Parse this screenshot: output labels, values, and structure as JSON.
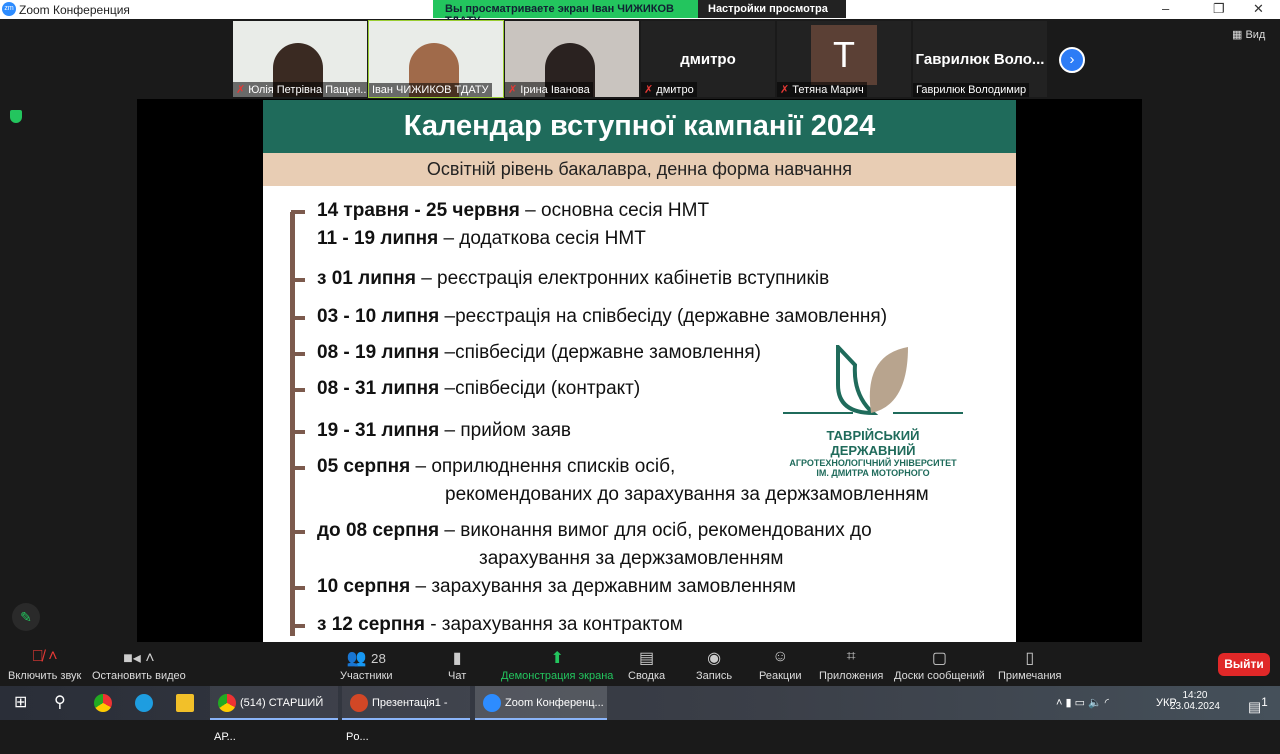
{
  "window": {
    "title": "Zoom Конференция",
    "minimize": "–",
    "maximize": "❐",
    "close": "✕"
  },
  "banner": {
    "viewing": "Вы просматриваете экран Іван ЧИЖИКОВ ТДАТУ",
    "settings": "Настройки просмотра",
    "chevron": "⌄"
  },
  "participants": [
    {
      "name": "Юлія Петрівна Пащен...",
      "muted": true
    },
    {
      "name": "Іван ЧИЖИКОВ ТДАТУ",
      "muted": false
    },
    {
      "name": "Ірина Іванова",
      "muted": true
    },
    {
      "name": "дмитро",
      "display": "дмитро",
      "muted": true
    },
    {
      "name": "Тетяна Марич",
      "display": "Т",
      "muted": true
    },
    {
      "name": "Гаврилюк Володимир",
      "display": "Гаврилюк  Воло...",
      "muted": false
    }
  ],
  "view_label": "Вид",
  "slide": {
    "title": "Календар вступної кампанії 2024",
    "subtitle": "Освітній рівень бакалавра, денна форма навчання",
    "items": [
      {
        "bold": "14 травня - 25 червня",
        "text": " – основна сесія НМТ"
      },
      {
        "bold": "11 - 19 липня",
        "text": " – додаткова сесія НМТ"
      },
      {
        "bold": "з 01 липня",
        "text": " – реєстрація електронних кабінетів вступників"
      },
      {
        "bold": "03 - 10 липня",
        "text": " –реєстрація на співбесіду (державне замовлення)"
      },
      {
        "bold": "08 - 19 липня",
        "text": " –співбесіди (державне замовлення)"
      },
      {
        "bold": "08 - 31 липня",
        "text": " –співбесіди (контракт)"
      },
      {
        "bold": "19 - 31 липня",
        "text": " – прийом заяв"
      },
      {
        "bold": "05 серпня",
        "text": " – оприлюднення списків осіб,",
        "cont": "рекомендованих до зарахування за держзамовленням"
      },
      {
        "bold": "до 08 серпня",
        "text": " – виконання вимог для осіб, рекомендованих до",
        "cont": "зарахування за держзамовленням"
      },
      {
        "bold": "10 серпня",
        "text": " – зарахування за державним замовленням"
      },
      {
        "bold": "з 12 серпня",
        "text": " - зарахування за контрактом"
      }
    ],
    "logo_line1": "ТАВРІЙСЬКИЙ ДЕРЖАВНИЙ",
    "logo_line2": "АГРОТЕХНОЛОГІЧНИЙ УНІВЕРСИТЕТ",
    "logo_line3": "ІМ. ДМИТРА МОТОРНОГО"
  },
  "toolbar": {
    "unmute": "Включить звук",
    "video": "Остановить видео",
    "participants": "Участники",
    "participants_count": "28",
    "chat": "Чат",
    "share": "Демонстрация экрана",
    "summary": "Сводка",
    "record": "Запись",
    "reactions": "Реакции",
    "apps": "Приложения",
    "whiteboards": "Доски сообщений",
    "notes": "Примечания",
    "exit": "Выйти"
  },
  "taskbar": {
    "chrome_tab": "(514) СТАРШИЙ АР...",
    "ppt": "Презентація1 - Po...",
    "zoom": "Zoom Конференц...",
    "lang": "УКР",
    "time": "14:20",
    "date": "23.04.2024",
    "notif": "1"
  },
  "colors": {
    "slide_header": "#1f6b5b",
    "subtitle_bg": "#e8cdb4",
    "timeline": "#7c5a4d",
    "banner": "#23c55e",
    "exit": "#e02828"
  }
}
